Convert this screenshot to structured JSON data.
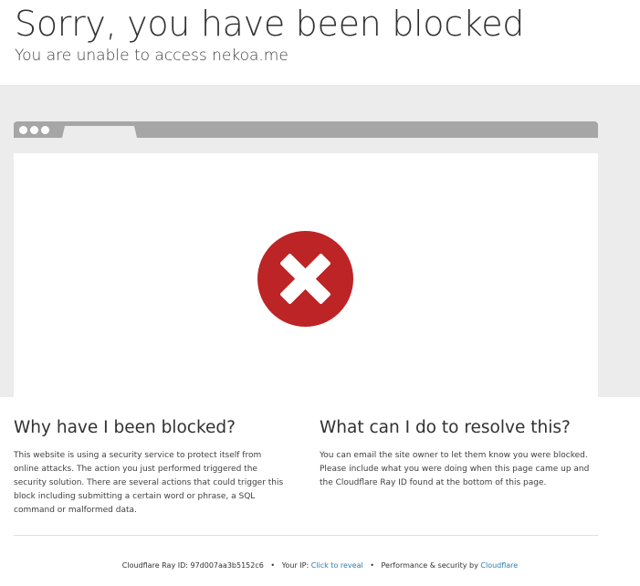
{
  "header": {
    "title": "Sorry, you have been blocked",
    "subtitle": "You are unable to access nekoa.me"
  },
  "error_icon": "close-x-circle-icon",
  "colors": {
    "error_red": "#bd2426",
    "link": "#2c7cb0",
    "band_gray": "#ececec",
    "bar_gray": "#a6a6a6"
  },
  "why": {
    "heading": "Why have I been blocked?",
    "body": "This website is using a security service to protect itself from online attacks. The action you just performed triggered the security solution. There are several actions that could trigger this block including submitting a certain word or phrase, a SQL command or malformed data."
  },
  "resolve": {
    "heading": "What can I do to resolve this?",
    "body": "You can email the site owner to let them know you were blocked. Please include what you were doing when this page came up and the Cloudflare Ray ID found at the bottom of this page."
  },
  "footer": {
    "ray_label": "Cloudflare Ray ID:",
    "ray_id": "97d007aa3b5152c6",
    "sep": "•",
    "ip_label": "Your IP:",
    "ip_link": "Click to reveal",
    "perf_label": "Performance & security by",
    "cf_link": "Cloudflare"
  }
}
